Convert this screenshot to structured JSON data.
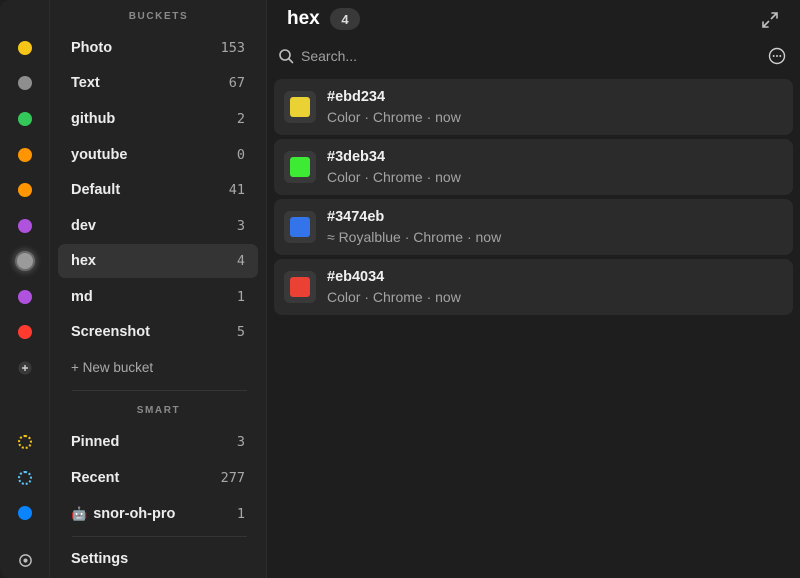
{
  "buckets_label": "BUCKETS",
  "smart_label": "SMART",
  "buckets": [
    {
      "label": "Photo",
      "count": "153",
      "color": "#f5c518"
    },
    {
      "label": "Text",
      "count": "67",
      "color": "#8e8e8e"
    },
    {
      "label": "github",
      "count": "2",
      "color": "#34c759"
    },
    {
      "label": "youtube",
      "count": "0",
      "color": "#ff9500"
    },
    {
      "label": "Default",
      "count": "41",
      "color": "#ff9500"
    },
    {
      "label": "dev",
      "count": "3",
      "color": "#af52de"
    },
    {
      "label": "hex",
      "count": "4",
      "color": "#9a9a9a"
    },
    {
      "label": "md",
      "count": "1",
      "color": "#af52de"
    },
    {
      "label": "Screenshot",
      "count": "5",
      "color": "#ff3b30"
    }
  ],
  "new_bucket_label": "+ New bucket",
  "smart": [
    {
      "label": "Pinned",
      "count": "3",
      "color": "#f5c518"
    },
    {
      "label": "Recent",
      "count": "277",
      "color": "#5ac8fa"
    },
    {
      "label": "snor-oh-pro",
      "count": "1",
      "color": "#0a84ff",
      "emoji": "🤖"
    }
  ],
  "settings_label": "Settings",
  "main": {
    "title": "hex",
    "count": "4",
    "search_placeholder": "Search..."
  },
  "items": [
    {
      "title": "#ebd234",
      "subtitle": "Color · Chrome · now",
      "swatch": "#ebd234"
    },
    {
      "title": "#3deb34",
      "subtitle": "Color · Chrome · now",
      "swatch": "#3deb34"
    },
    {
      "title": "#3474eb",
      "subtitle": "≈ Royalblue · Chrome · now",
      "swatch": "#3474eb"
    },
    {
      "title": "#eb4034",
      "subtitle": "Color · Chrome · now",
      "swatch": "#eb4034"
    }
  ],
  "icons": {
    "add": "plus-icon",
    "settings": "gear-icon",
    "expand": "expand-icon",
    "search": "search-icon",
    "more": "more-icon"
  }
}
